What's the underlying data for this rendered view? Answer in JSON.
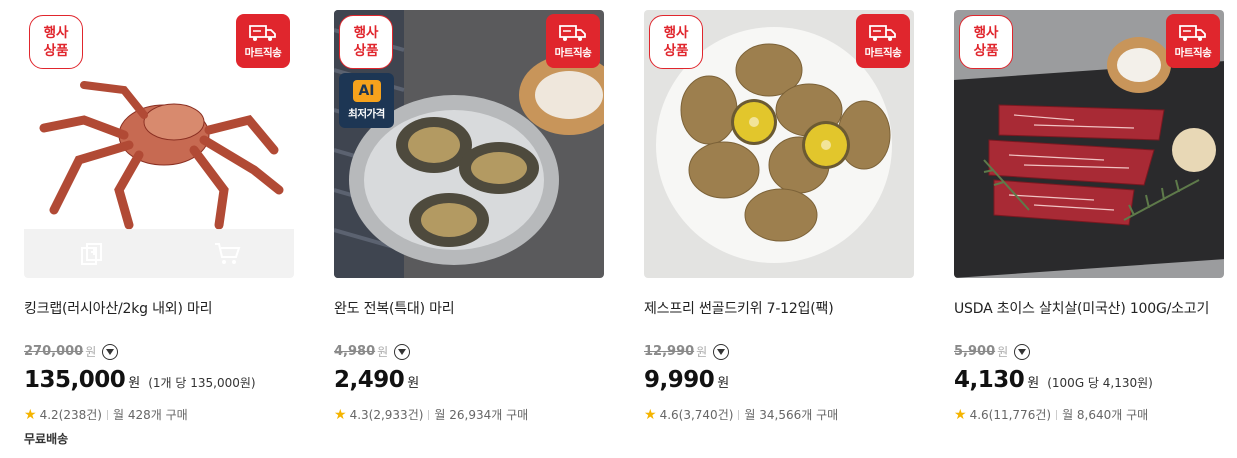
{
  "badges": {
    "event": [
      "행사",
      "상품"
    ],
    "shipping": "마트직송",
    "ai_logo": "AI",
    "ai_label": "최저가격"
  },
  "products": [
    {
      "title": "킹크랩(러시아산/2kg 내외) 마리",
      "original_price": "270,000",
      "currency": "원",
      "price": "135,000",
      "unit_price": "(1개 당 135,000원)",
      "rating": "4.2",
      "reviews": "(238건)",
      "monthly": "월 428개 구매",
      "free_shipping": "무료배송"
    },
    {
      "title": "완도 전복(특대) 마리",
      "original_price": "4,980",
      "currency": "원",
      "price": "2,490",
      "unit_price": "",
      "rating": "4.3",
      "reviews": "(2,933건)",
      "monthly": "월 26,934개 구매",
      "free_shipping": ""
    },
    {
      "title": "제스프리 썬골드키위 7-12입(팩)",
      "original_price": "12,990",
      "currency": "원",
      "price": "9,990",
      "unit_price": "",
      "rating": "4.6",
      "reviews": "(3,740건)",
      "monthly": "월 34,566개 구매",
      "free_shipping": ""
    },
    {
      "title": "USDA 초이스 살치살(미국산) 100G/소고기",
      "original_price": "5,900",
      "currency": "원",
      "price": "4,130",
      "unit_price": "(100G 당 4,130원)",
      "rating": "4.6",
      "reviews": "(11,776건)",
      "monthly": "월 8,640개 구매",
      "free_shipping": ""
    }
  ],
  "icons": {
    "truck": "truck-icon",
    "compare": "compare-icon",
    "cart": "cart-icon",
    "chevron": "chevron-down-icon",
    "star": "star-icon"
  },
  "colors": {
    "accent": "#e0262d",
    "star": "#f5b400",
    "ai_bg": "#1d3654",
    "ai_accent": "#f6a21c"
  }
}
